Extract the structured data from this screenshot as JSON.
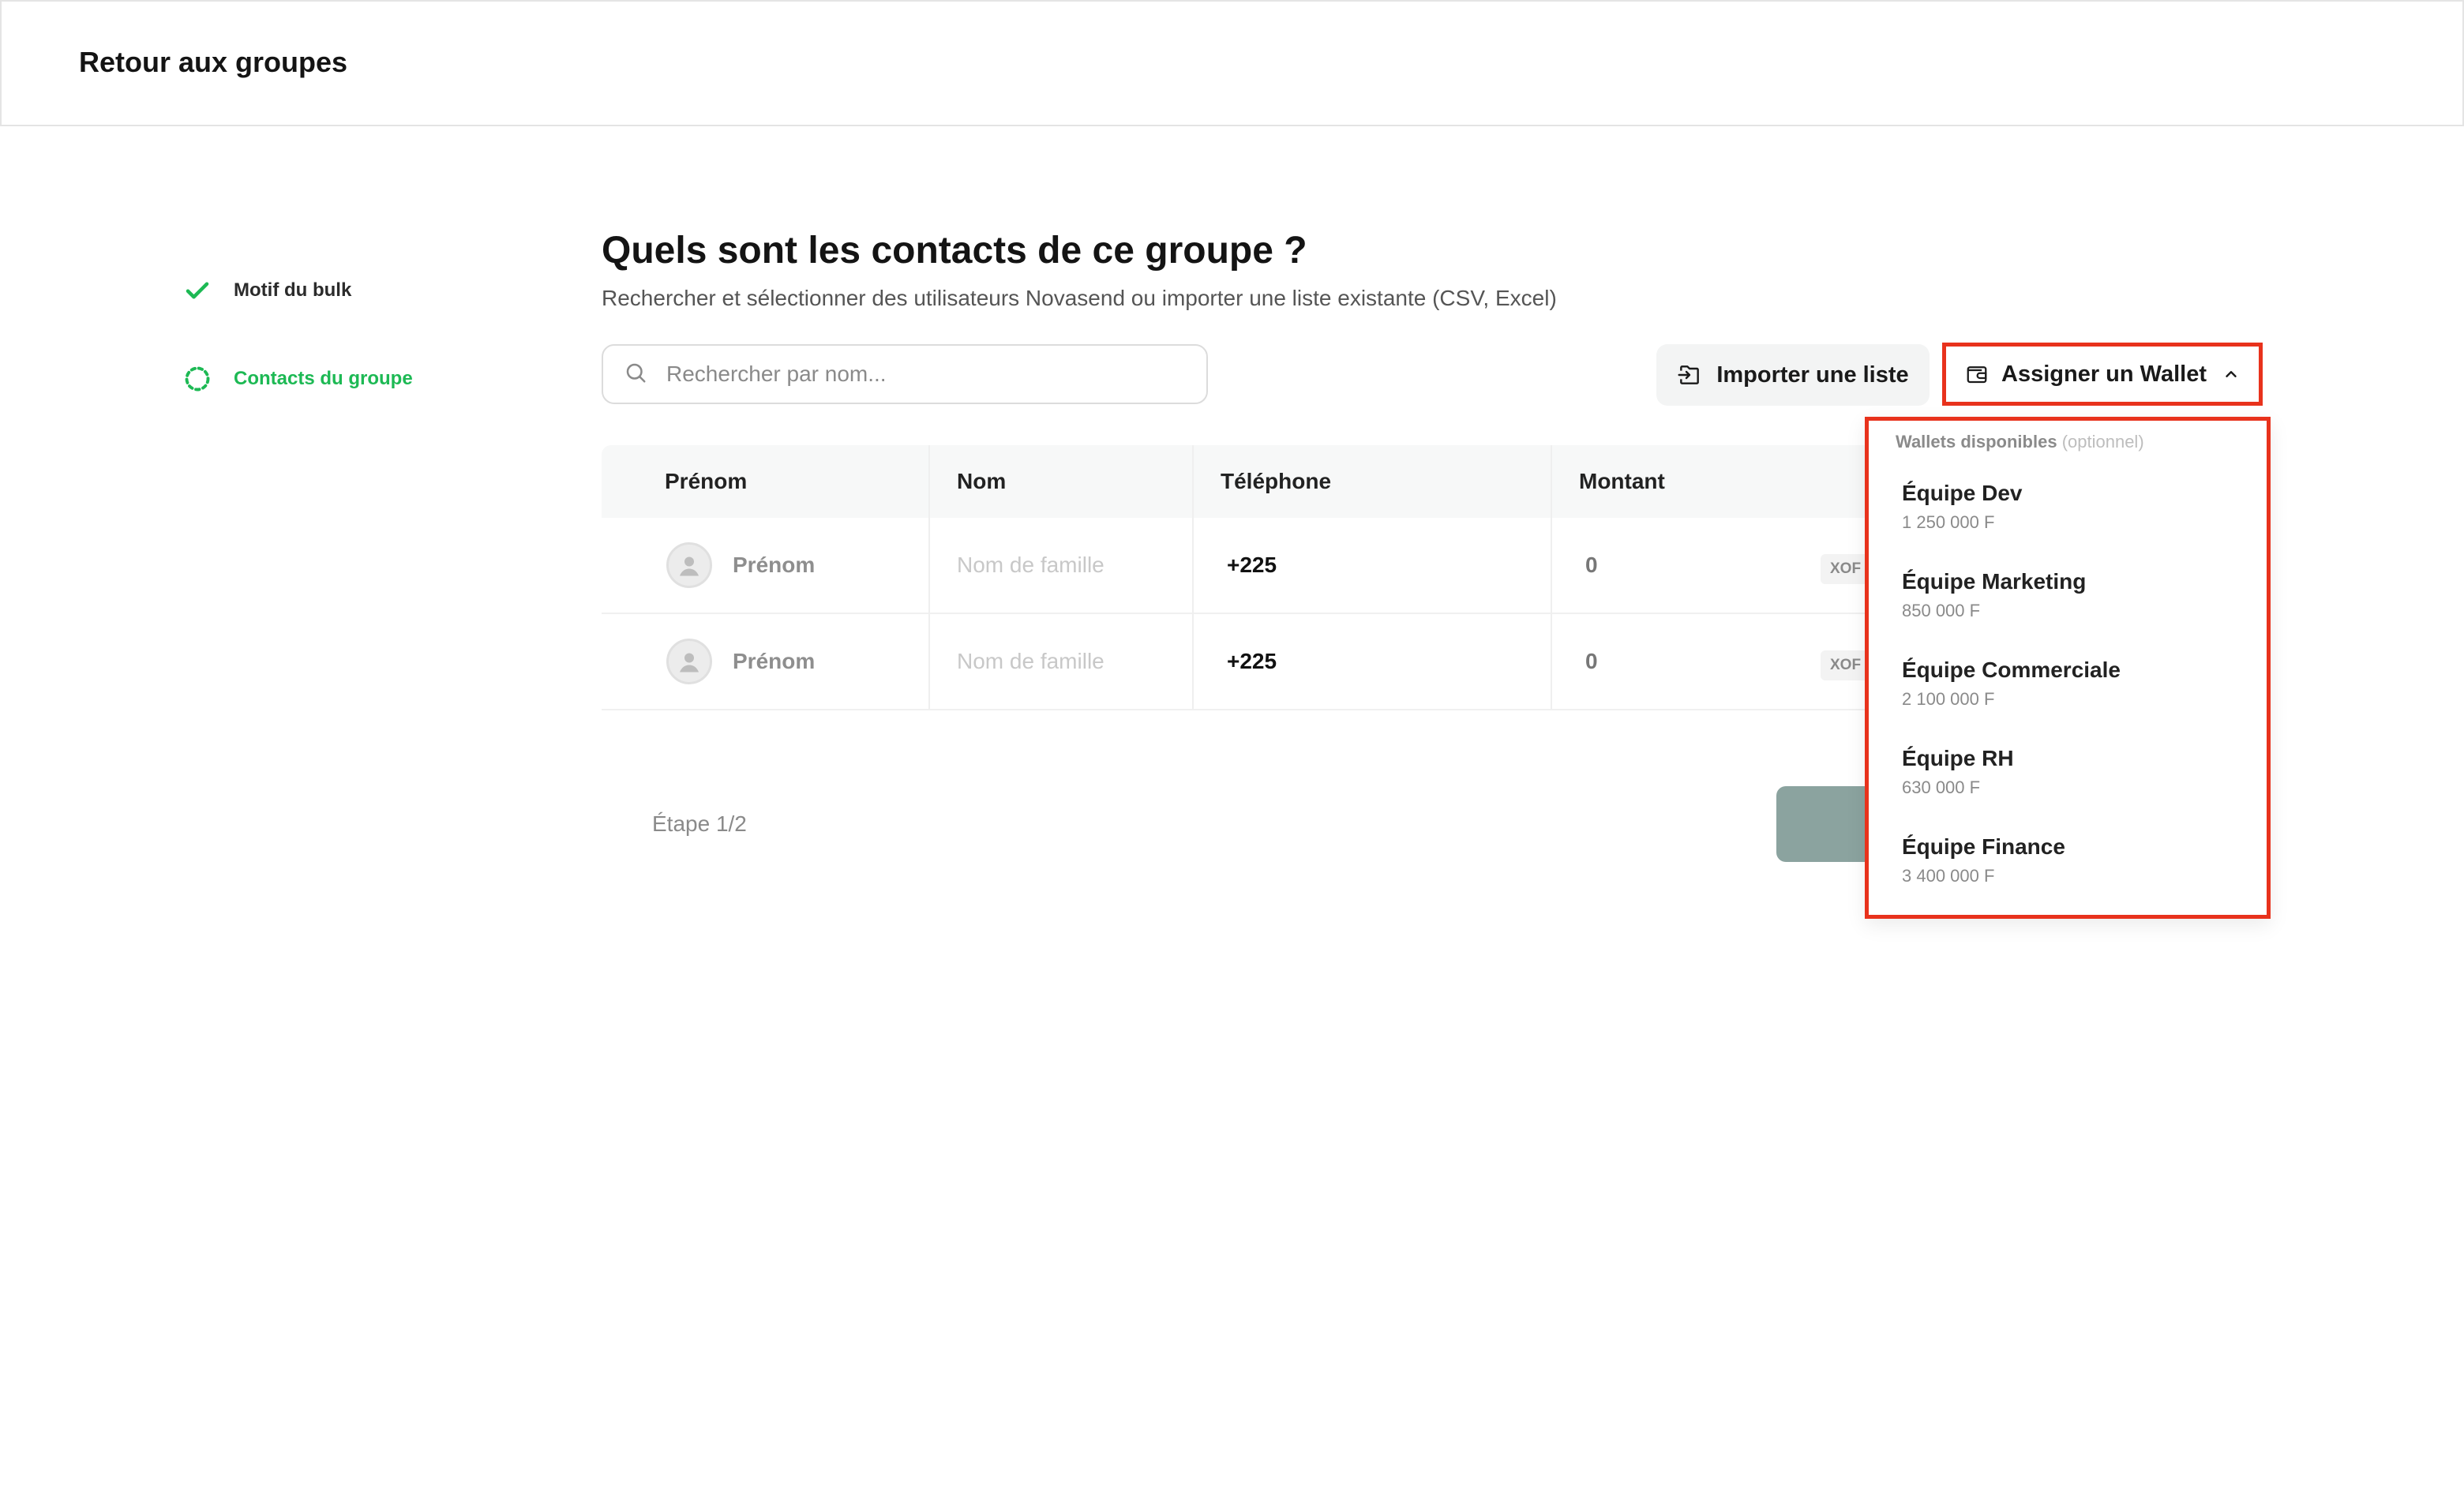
{
  "header": {
    "back_label": "Retour aux groupes"
  },
  "stepper": {
    "steps": [
      {
        "label": "Motif du bulk",
        "status": "done"
      },
      {
        "label": "Contacts du groupe",
        "status": "current"
      }
    ]
  },
  "main": {
    "title": "Quels sont les contacts de ce groupe ?",
    "subtitle": "Rechercher et sélectionner des utilisateurs Novasend ou importer une liste existante (CSV, Excel)",
    "search_placeholder": "Rechercher par nom...",
    "import_label": "Importer une liste",
    "wallet_label": "Assigner un Wallet"
  },
  "table": {
    "columns": [
      "Prénom",
      "Nom",
      "Téléphone",
      "Montant"
    ],
    "rows": [
      {
        "prenom": "Prénom",
        "nom": "Nom de famille",
        "telephone": "+225",
        "montant": "0",
        "currency": "XOF"
      },
      {
        "prenom": "Prénom",
        "nom": "Nom de famille",
        "telephone": "+225",
        "montant": "0",
        "currency": "XOF"
      }
    ]
  },
  "footer": {
    "step_indicator": "Étape 1/2"
  },
  "wallet_dropdown": {
    "header": "Wallets disponibles",
    "header_optional": "(optionnel)",
    "items": [
      {
        "name": "Équipe Dev",
        "balance": "1 250 000 F"
      },
      {
        "name": "Équipe Marketing",
        "balance": "850 000 F"
      },
      {
        "name": "Équipe Commerciale",
        "balance": "2 100 000 F"
      },
      {
        "name": "Équipe RH",
        "balance": "630 000 F"
      },
      {
        "name": "Équipe Finance",
        "balance": "3 400 000 F"
      }
    ]
  },
  "colors": {
    "accent_green": "#1db954",
    "highlight_red": "#e8321c",
    "next_button": "#8ba39f"
  }
}
